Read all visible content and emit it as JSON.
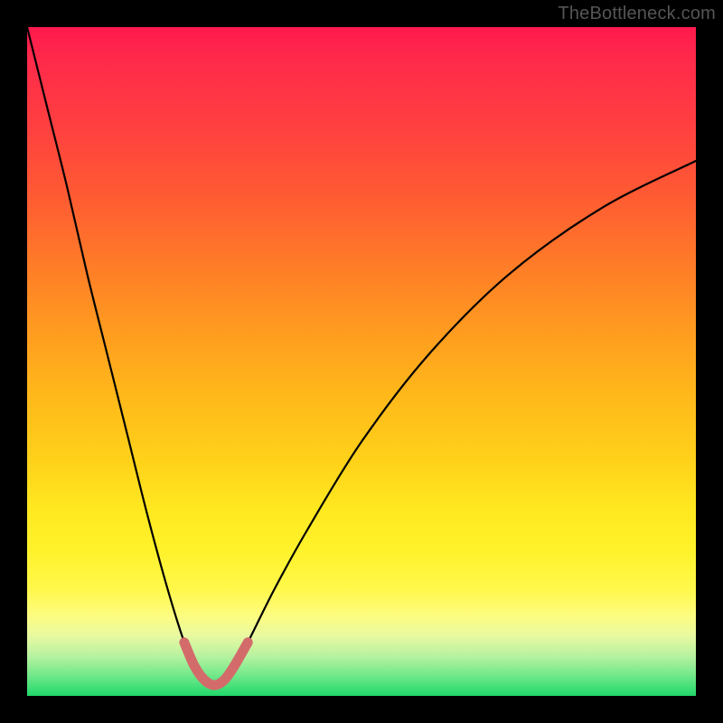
{
  "watermark": "TheBottleneck.com",
  "colors": {
    "frame_background": "#000000",
    "curve_stroke": "#000000",
    "highlight_stroke": "#d36b6b",
    "gradient_top": "#ff1a4d",
    "gradient_bottom": "#20d86a"
  },
  "chart_data": {
    "type": "line",
    "title": "",
    "xlabel": "",
    "ylabel": "",
    "xlim": [
      0,
      100
    ],
    "ylim": [
      0,
      100
    ],
    "grid": false,
    "legend": false,
    "annotations": [],
    "description": "V-shaped bottleneck curve: high at both x extremes, minimum near x≈28. Background is a vertical red→green rainbow gradient. A short salmon-colored highlight marks the bottom of the V.",
    "series": [
      {
        "name": "bottleneck-curve",
        "x": [
          0,
          3,
          6,
          9,
          12,
          15,
          18,
          21,
          23.5,
          25,
          26.5,
          28,
          29.5,
          31,
          33,
          37,
          42,
          50,
          60,
          72,
          86,
          100
        ],
        "y": [
          100,
          88,
          76,
          63,
          51,
          39,
          27,
          16,
          8,
          4.5,
          2.4,
          1.6,
          2.4,
          4.5,
          8,
          16,
          25,
          38,
          51,
          63,
          73,
          80
        ]
      },
      {
        "name": "highlight-segment",
        "x": [
          23.5,
          25,
          26.5,
          28,
          29.5,
          31,
          33
        ],
        "y": [
          8,
          4.5,
          2.4,
          1.6,
          2.4,
          4.5,
          8
        ]
      }
    ]
  }
}
